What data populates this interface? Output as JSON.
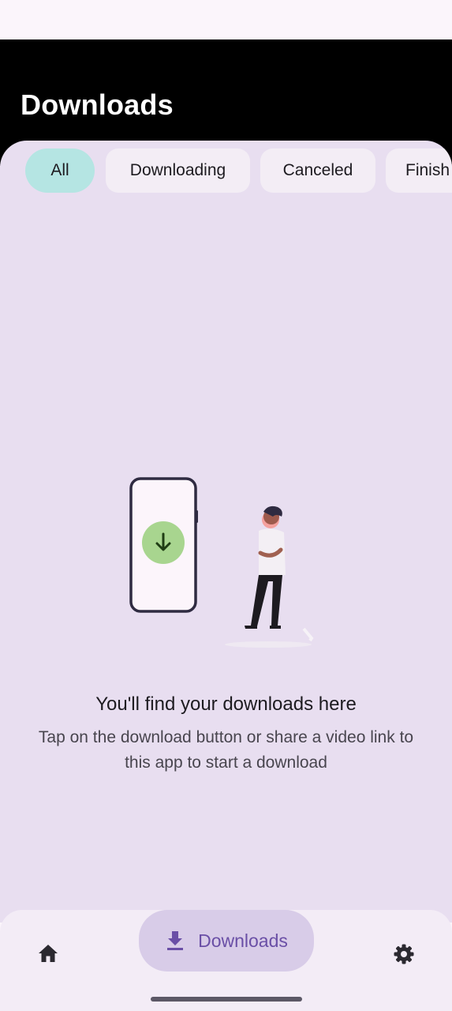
{
  "app_bar": {
    "title": "Downloads"
  },
  "filter_chips": [
    {
      "label": "All",
      "selected": true
    },
    {
      "label": "Downloading",
      "selected": false
    },
    {
      "label": "Canceled",
      "selected": false
    },
    {
      "label": "Finish",
      "selected": false
    }
  ],
  "empty_state": {
    "title": "You'll find your downloads here",
    "body": "Tap on the download button or share a video link to this app to start a download",
    "illustration": "phone-download-person"
  },
  "bottom_nav": {
    "items": [
      {
        "label": "",
        "icon": "home-icon"
      },
      {
        "label": "Downloads",
        "icon": "download-icon",
        "selected": true
      },
      {
        "label": "",
        "icon": "gear-icon"
      }
    ]
  },
  "colors": {
    "sheet_bg": "#e8def0",
    "chip_selected": "#b5e5e3",
    "nav_indicator": "#d8cce8",
    "accent": "#6a4fa6"
  }
}
